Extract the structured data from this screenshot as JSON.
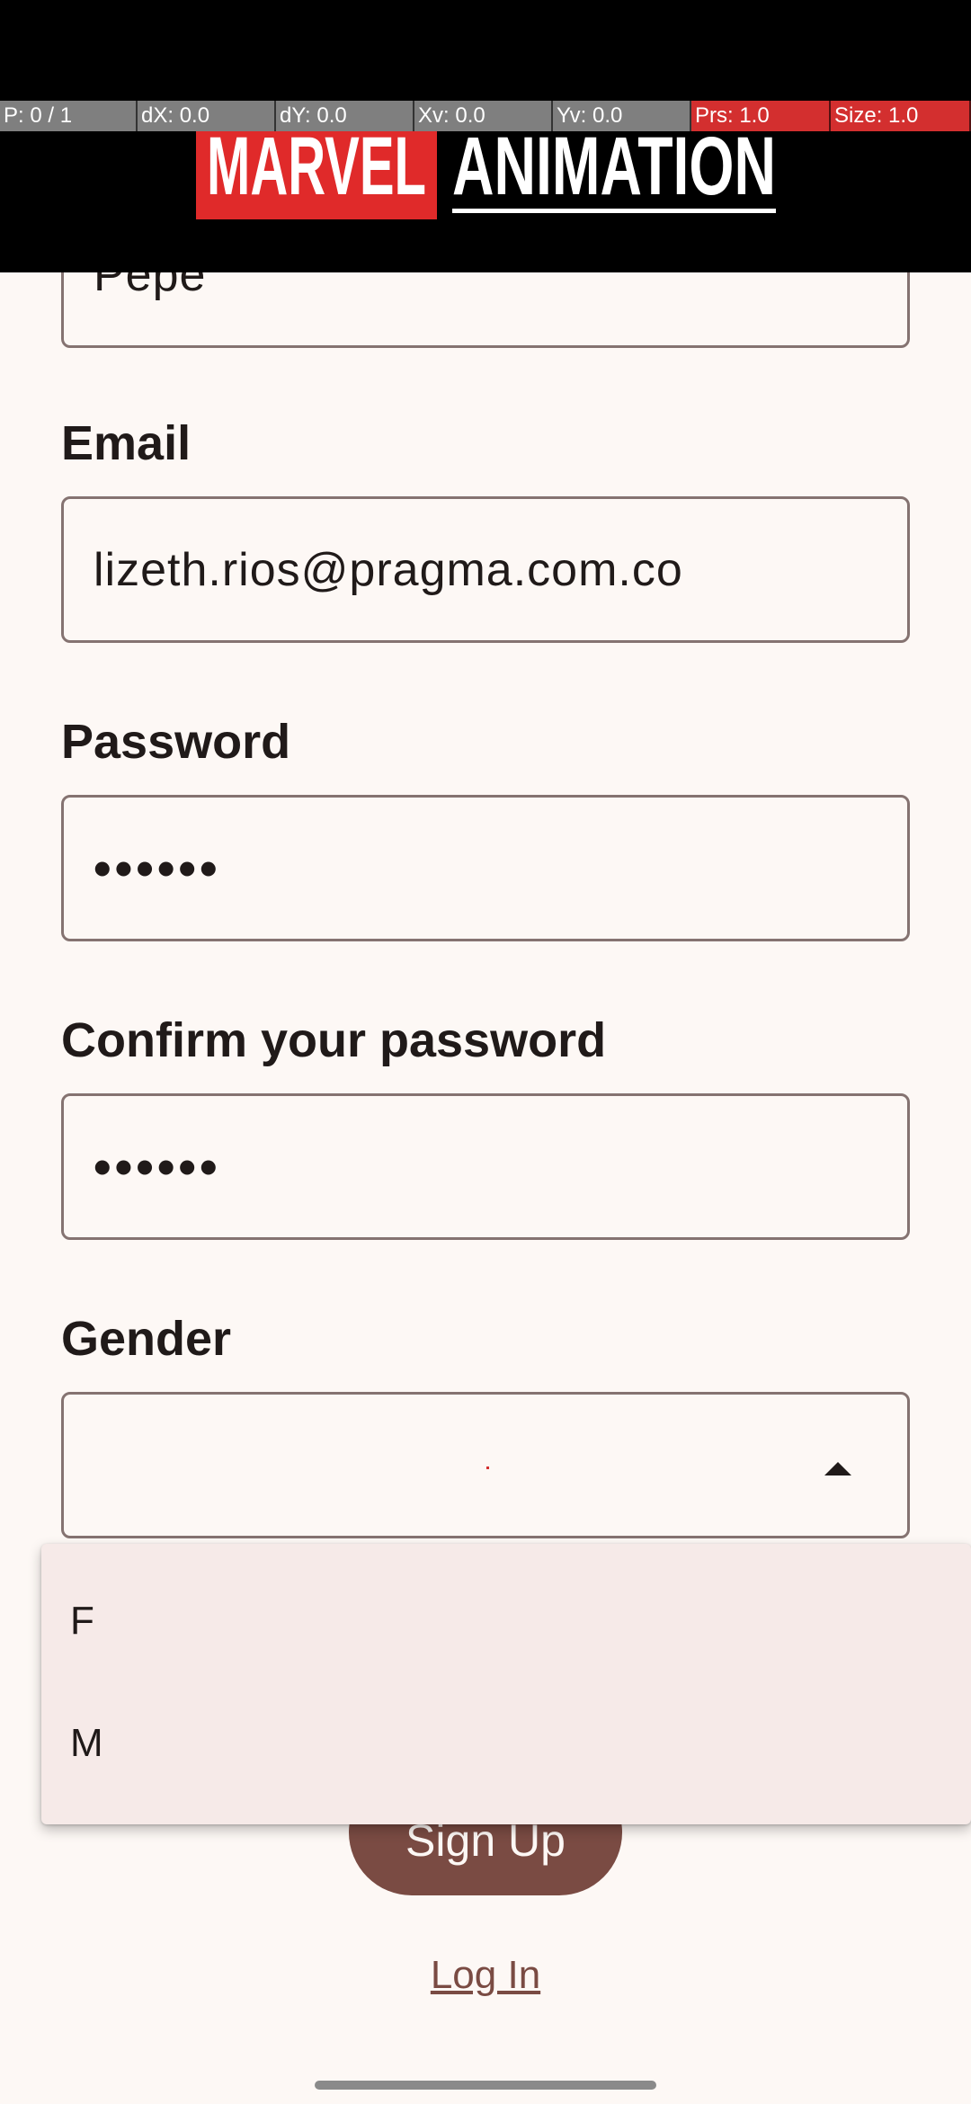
{
  "debug": {
    "pointer": "P: 0 / 1",
    "dx": "dX: 0.0",
    "dy": "dY: 0.0",
    "xv": "Xv: 0.0",
    "yv": "Yv: 0.0",
    "prs": "Prs: 1.0",
    "size": "Size: 1.0"
  },
  "logo": {
    "left": "MARVEL",
    "right": "ANIMATION",
    "color_red": "#e02a2a"
  },
  "form": {
    "name_value": "Pepe",
    "email_label": "Email",
    "email_value": "lizeth.rios@pragma.com.co",
    "password_label": "Password",
    "password_value": "••••••",
    "confirm_label": "Confirm your password",
    "confirm_value": "••••••",
    "gender_label": "Gender",
    "gender_value": ""
  },
  "menu": {
    "options": [
      "F",
      "M"
    ]
  },
  "actions": {
    "signup_label": "Sign Up",
    "login_label": "Log In"
  },
  "colors": {
    "primary": "#7a4b43",
    "background": "#fdf8f5",
    "menu_bg": "#f6eae8",
    "outline": "#857371"
  }
}
